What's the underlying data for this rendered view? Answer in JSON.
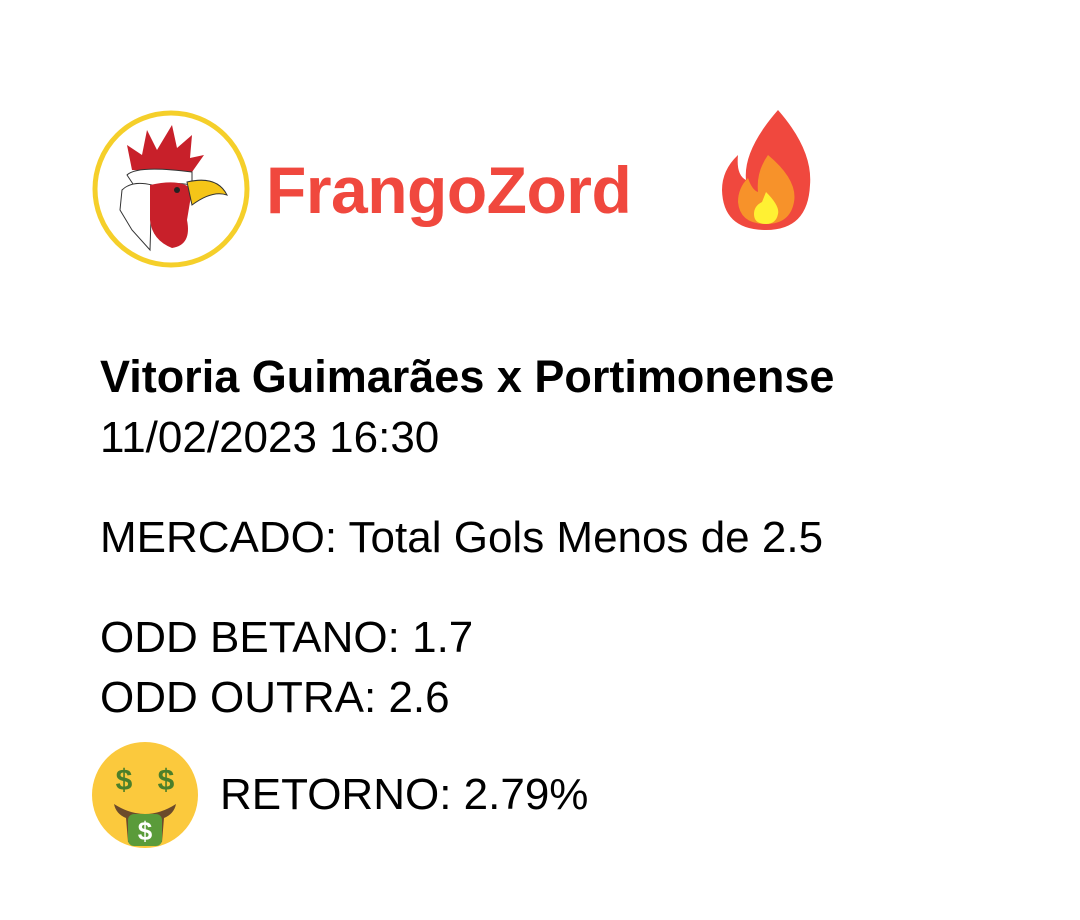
{
  "brand": {
    "name": "FrangoZord",
    "logo_icon": "rooster-icon",
    "decor_icon": "fire-icon",
    "color": "#f0483e"
  },
  "match": {
    "title": "Vitoria Guimarães x Portimonense",
    "datetime": "11/02/2023 16:30",
    "market": "MERCADO: Total Gols Menos de 2.5",
    "odd_betano": "ODD BETANO: 1.7",
    "odd_outra": "ODD OUTRA: 2.6",
    "retorno": "RETORNO: 2.79%",
    "retorno_icon": "money-mouth-face-icon"
  }
}
